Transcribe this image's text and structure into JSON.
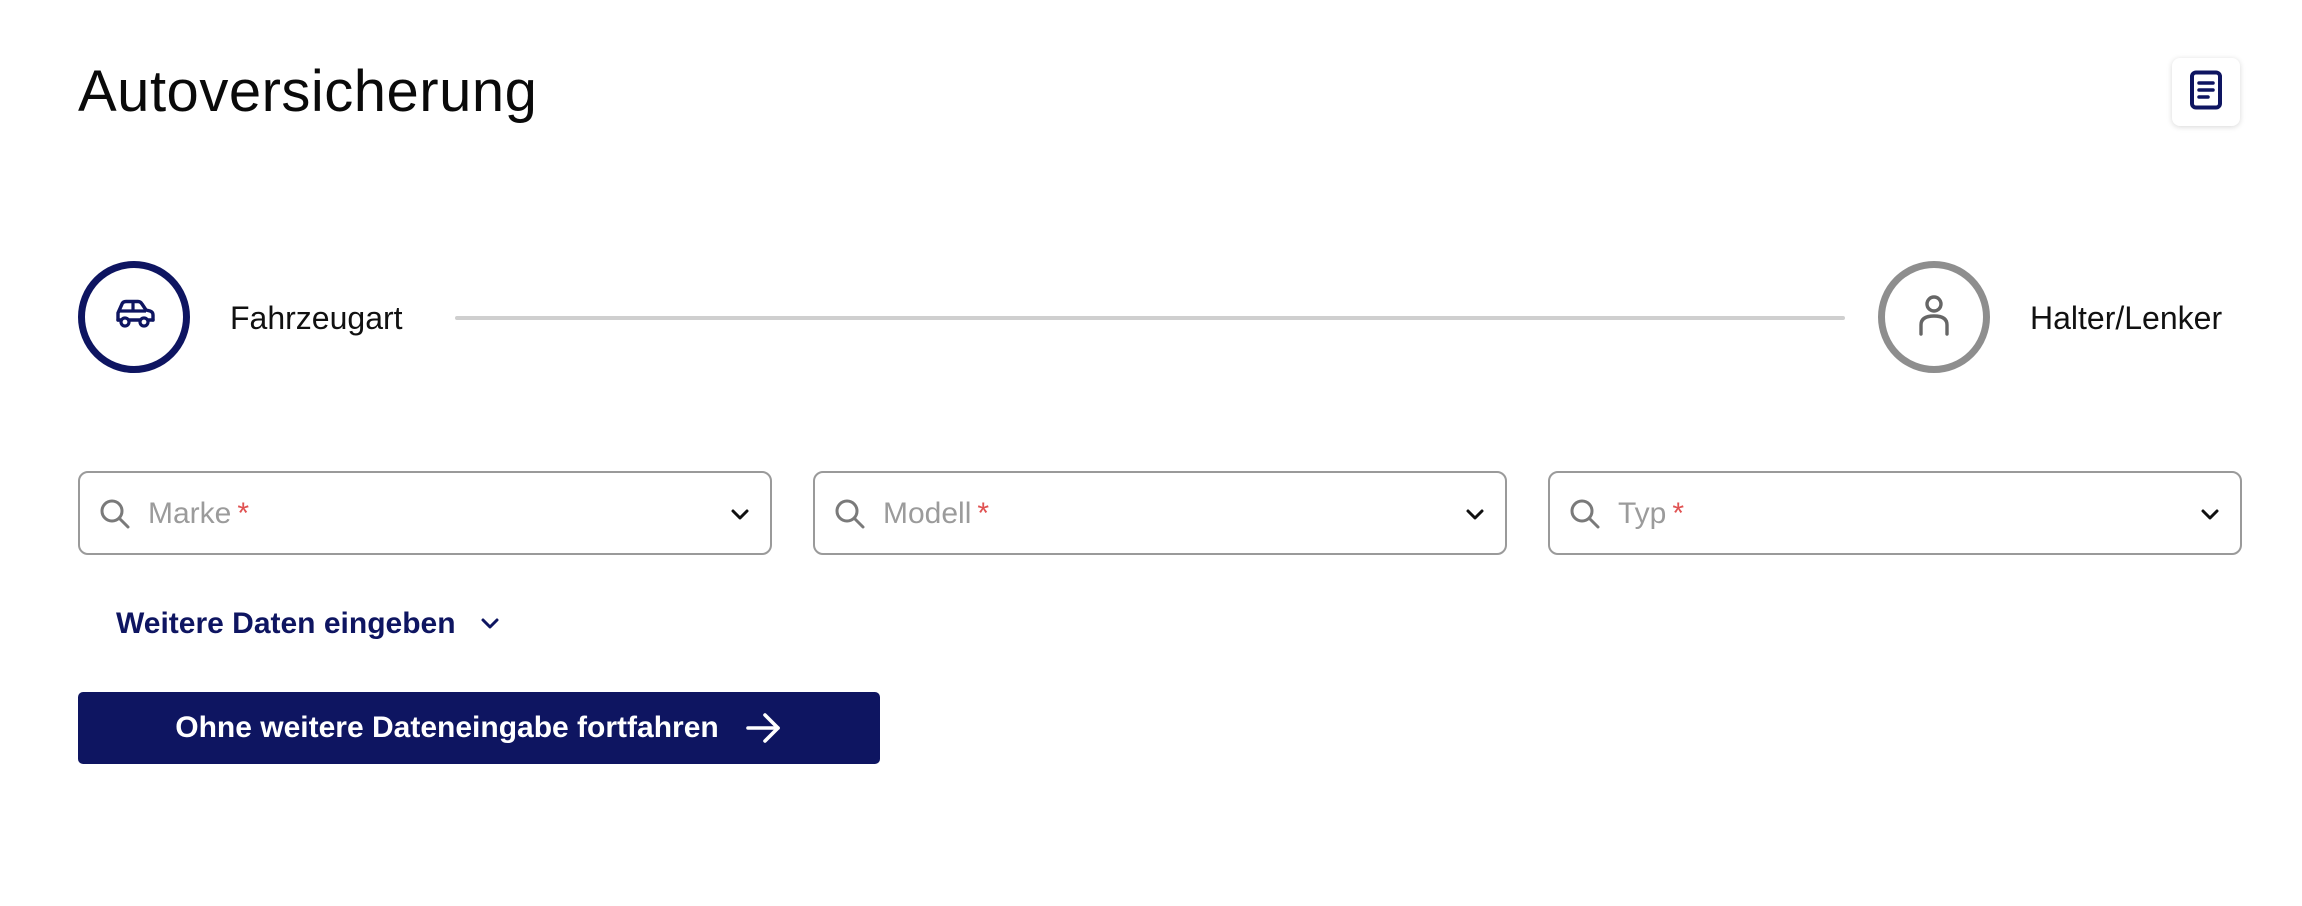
{
  "header": {
    "title": "Autoversicherung",
    "doc_icon": "document-list-icon"
  },
  "stepper": {
    "steps": [
      {
        "label": "Fahrzeugart",
        "icon": "car-icon",
        "state": "active"
      },
      {
        "label": "Halter/Lenker",
        "icon": "person-icon",
        "state": "inactive"
      }
    ]
  },
  "fields": [
    {
      "placeholder": "Marke",
      "required_mark": "*",
      "icon": "search-icon"
    },
    {
      "placeholder": "Modell",
      "required_mark": "*",
      "icon": "search-icon"
    },
    {
      "placeholder": "Typ",
      "required_mark": "*",
      "icon": "search-icon"
    }
  ],
  "more_data": {
    "label": "Weitere Daten eingeben"
  },
  "continue_button": {
    "label": "Ohne weitere Dateneingabe fortfahren"
  },
  "colors": {
    "primary": "#0e1561",
    "inactive": "#8e8e8e",
    "required": "#e05252",
    "placeholder": "#9b9b9b",
    "border": "#9a9a9a"
  }
}
